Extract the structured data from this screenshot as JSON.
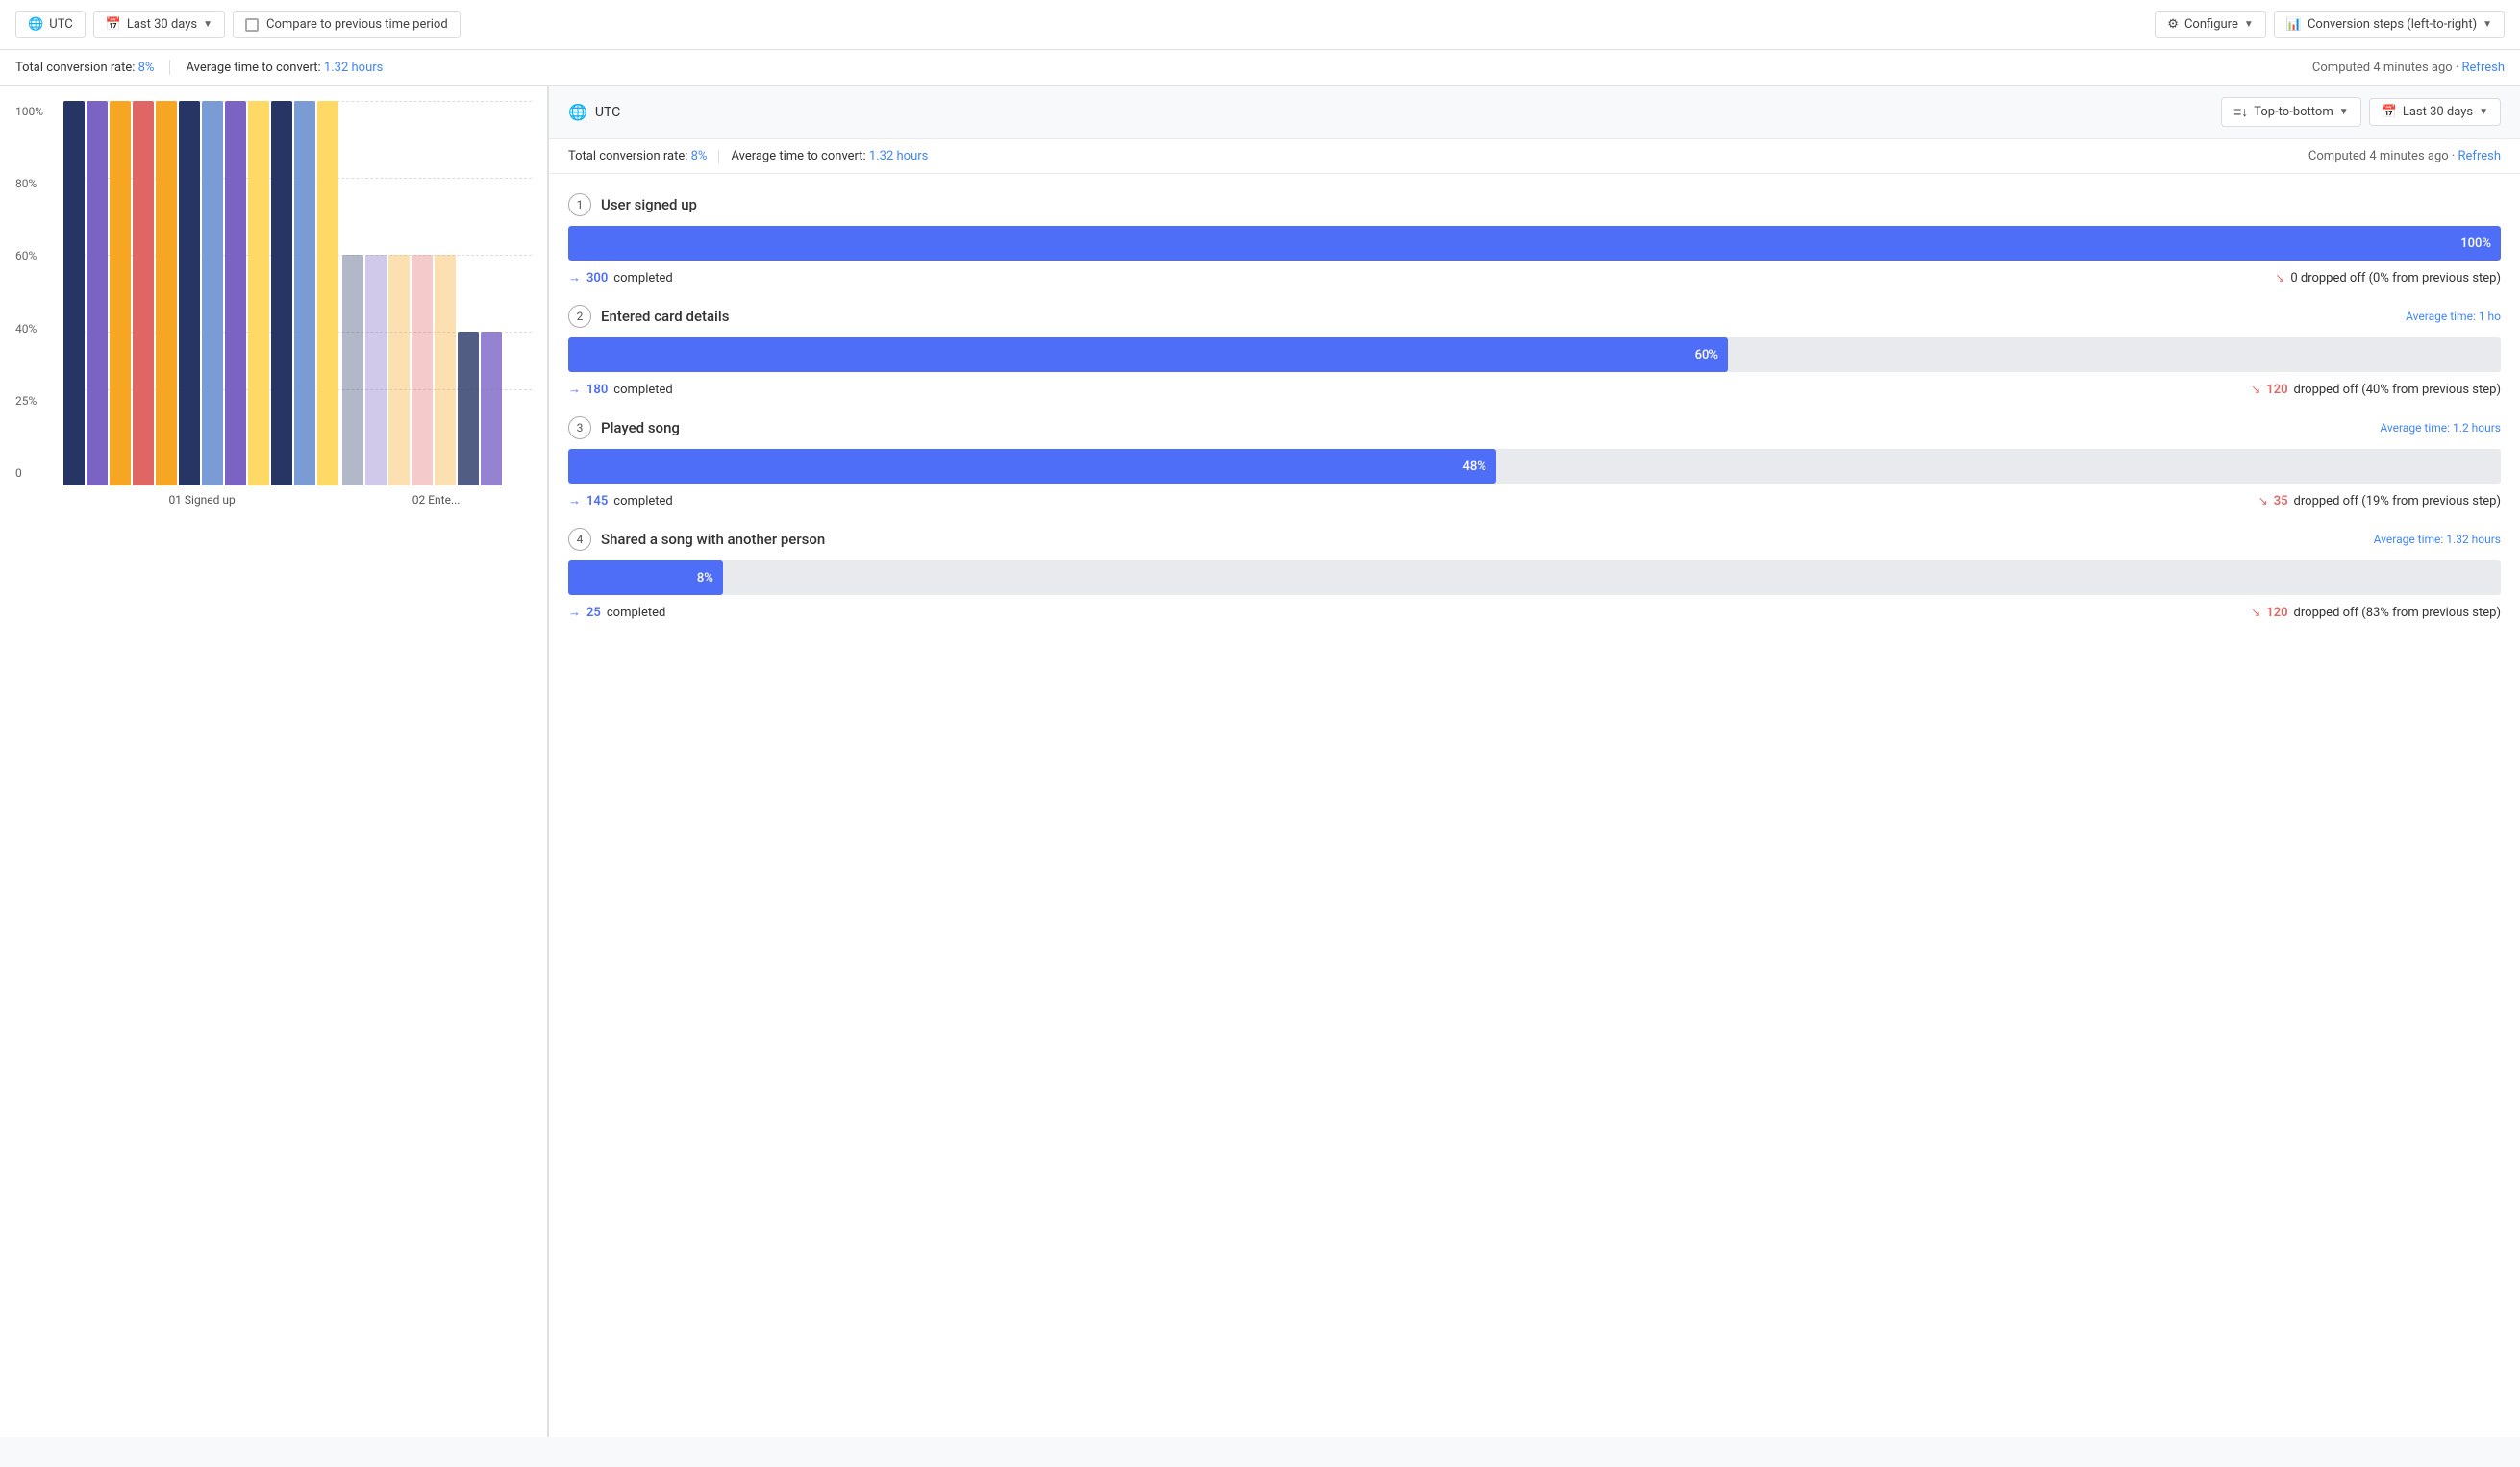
{
  "topBar": {
    "timezone": "UTC",
    "dateRange": "Last 30 days",
    "compare_label": "Compare to previous time period",
    "configure_label": "Configure",
    "conversion_steps_label": "Conversion steps (left-to-right)"
  },
  "statsBar": {
    "total_conversion_prefix": "Total conversion rate:",
    "total_conversion_value": "8%",
    "avg_time_prefix": "Average time to convert:",
    "avg_time_value": "1.32 hours",
    "computed_text": "Computed 4 minutes ago · ",
    "refresh_label": "Refresh"
  },
  "panel": {
    "timezone": "UTC",
    "sort_label": "Top-to-bottom",
    "date_range": "Last 30 days",
    "total_conversion_prefix": "Total conversion rate:",
    "total_conversion_value": "8%",
    "avg_time_prefix": "Average time to convert:",
    "avg_time_value": "1.32 hours",
    "computed_text": "Computed 4 minutes ago · ",
    "refresh_label": "Refresh",
    "steps": [
      {
        "number": "1",
        "title": "User signed up",
        "avg_time": null,
        "progress_pct": 100,
        "progress_label": "100%",
        "completed_count": "300",
        "completed_text": "completed",
        "dropped_count": "0",
        "dropped_text": "dropped off (0% from previous step)"
      },
      {
        "number": "2",
        "title": "Entered card details",
        "avg_time_prefix": "Average time: ",
        "avg_time_value": "1 ho",
        "progress_pct": 60,
        "progress_label": "60%",
        "completed_count": "180",
        "completed_text": "completed",
        "dropped_count": "120",
        "dropped_text": "dropped off (40% from previous step)"
      },
      {
        "number": "3",
        "title": "Played song",
        "avg_time_prefix": "Average time: ",
        "avg_time_value": "1.2 hours",
        "progress_pct": 48,
        "progress_label": "48%",
        "completed_count": "145",
        "completed_text": "completed",
        "dropped_count": "35",
        "dropped_text": "dropped off (19% from previous step)"
      },
      {
        "number": "4",
        "title": "Shared a song with another person",
        "avg_time_prefix": "Average time: ",
        "avg_time_value": "1.32 hours",
        "progress_pct": 8,
        "progress_label": "8%",
        "completed_count": "25",
        "completed_text": "completed",
        "dropped_count": "120",
        "dropped_text": "dropped off (83% from previous step)"
      }
    ]
  },
  "chart": {
    "y_labels": [
      "100%",
      "80%",
      "60%",
      "40%",
      "25%",
      "0"
    ],
    "group1_label": "01 Signed up",
    "group2_label": "02 Ente..."
  }
}
